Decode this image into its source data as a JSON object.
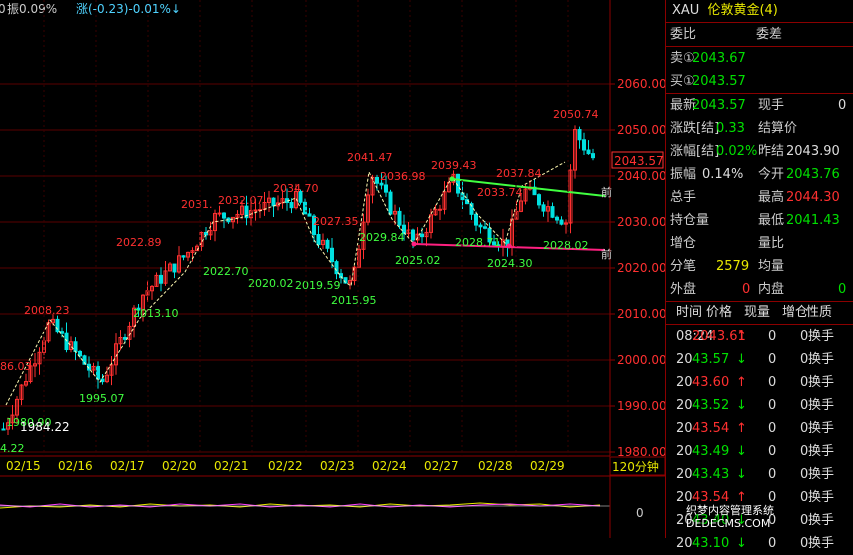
{
  "top_info": {
    "prefix": "0",
    "amp": "振0.09%",
    "chg": "涨(-0.23)-0.01%↓"
  },
  "timeframe": "120分钟",
  "dates": [
    "02/15",
    "02/16",
    "02/17",
    "02/20",
    "02/21",
    "02/22",
    "02/23",
    "02/24",
    "02/27",
    "02/28",
    "02/29"
  ],
  "price_ticks": [
    "2060.00",
    "2050.00",
    "2040.00",
    "2030.00",
    "2020.00",
    "2010.00",
    "2000.00",
    "1990.00",
    "1980.00"
  ],
  "current_price_tag": "2043.57",
  "sub_zero": "0",
  "red_annotations": [
    "2008.23",
    "2022.89",
    "2031.",
    "2032.07",
    "2034.70",
    "2027.35",
    "2041.47",
    "2036.98",
    "2039.43",
    "2037.84",
    "2033.74",
    "2050.74",
    "86.03"
  ],
  "green_annotations": [
    "1980.90",
    "1995.07",
    "2013.10",
    "2022.70",
    "2020.02",
    "2019.59",
    "2015.95",
    "2029.84",
    "2025.02",
    "2028.71",
    "2024.30",
    "2028.02",
    "4.22"
  ],
  "white_annotations": [
    "1984.22"
  ],
  "line_labels": [
    "前",
    "前"
  ],
  "panel": {
    "header_code": "XAU",
    "header_name": "伦敦黄金(4)",
    "weibi": "委比",
    "weicha": "委差",
    "sell_label": "卖①",
    "sell_val": "2043.67",
    "buy_label": "买①",
    "buy_val": "2043.57",
    "latest_label": "最新",
    "latest_val": "2043.57",
    "xianshou_label": "现手",
    "xianshou_val": "0",
    "zhangdie_label": "涨跌[结]",
    "zhangdie_val": "0.33",
    "jiesuan_label": "结算价",
    "zhangfu_label": "涨幅[结]",
    "zhangfu_val": "0.02%",
    "zuojie_label": "昨结",
    "zuojie_val": "2043.90",
    "zhenfu_label": "振幅",
    "zhenfu_val": "0.14%",
    "jinkai_label": "今开",
    "jinkai_val": "2043.76",
    "zongshou_label": "总手",
    "zuigao_label": "最高",
    "zuigao_val": "2044.30",
    "chicang_label": "持仓量",
    "zuidi_label": "最低",
    "zuidi_val": "2041.43",
    "zengcang_label": "增仓",
    "liangbi_label": "量比",
    "fenbi_label": "分笔",
    "fenbi_val": "2579",
    "junliang_label": "均量",
    "waipan_label": "外盘",
    "waipan_val": "0",
    "neipan_label": "内盘",
    "neipan_val": "0",
    "ticks_header": {
      "time": "时间",
      "price": "价格",
      "vol": "现量",
      "oi": "增仓",
      "nature": "性质"
    },
    "ticks": [
      {
        "t": "08:24",
        "p": "2043.61",
        "d": "↑",
        "v": "0",
        "o": "0",
        "n": "换手"
      },
      {
        "t": "20",
        "p": "43.57",
        "d": "↓",
        "v": "0",
        "o": "0",
        "n": "换手"
      },
      {
        "t": "20",
        "p": "43.60",
        "d": "↑",
        "v": "0",
        "o": "0",
        "n": "换手"
      },
      {
        "t": "20",
        "p": "43.52",
        "d": "↓",
        "v": "0",
        "o": "0",
        "n": "换手"
      },
      {
        "t": "20",
        "p": "43.54",
        "d": "↑",
        "v": "0",
        "o": "0",
        "n": "换手"
      },
      {
        "t": "20",
        "p": "43.49",
        "d": "↓",
        "v": "0",
        "o": "0",
        "n": "换手"
      },
      {
        "t": "20",
        "p": "43.43",
        "d": "↓",
        "v": "0",
        "o": "0",
        "n": "换手"
      },
      {
        "t": "20",
        "p": "43.54",
        "d": "↑",
        "v": "0",
        "o": "0",
        "n": "换手"
      },
      {
        "t": "20",
        "p": "43.40",
        "d": "↓",
        "v": "0",
        "o": "0",
        "n": "换手"
      },
      {
        "t": "20",
        "p": "43.10",
        "d": "↓",
        "v": "0",
        "o": "0",
        "n": "换手"
      }
    ]
  },
  "watermark": "织梦内容管理系统 DEDECMS.COM",
  "colors": {
    "up": "#ff3030",
    "down": "#00e0e0",
    "grid": "#8b0000",
    "support": "#ff2080",
    "resist": "#40ff40"
  }
}
